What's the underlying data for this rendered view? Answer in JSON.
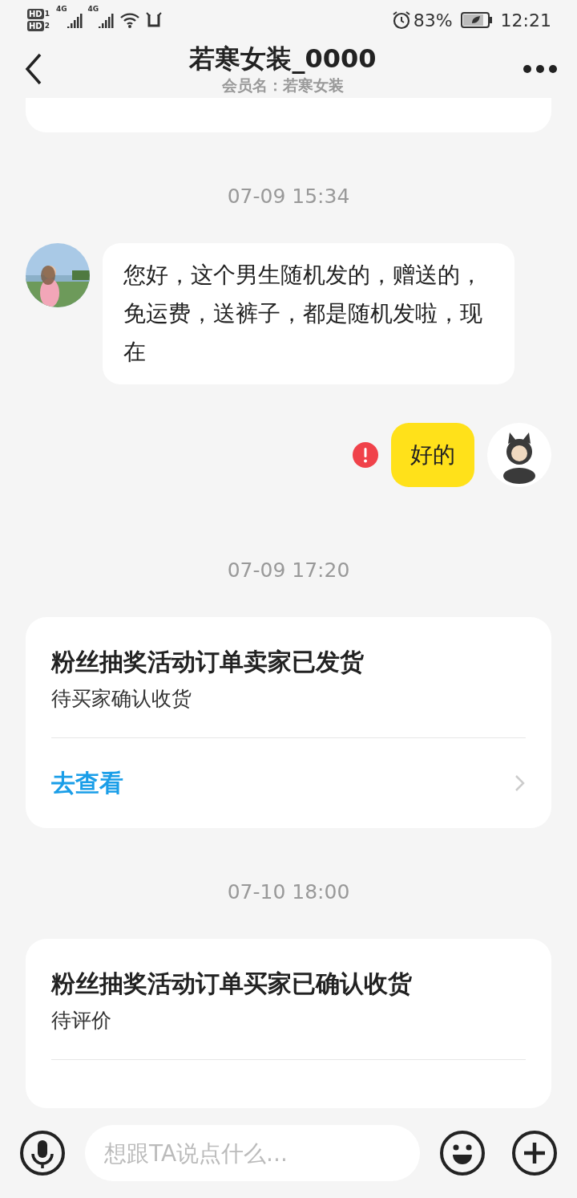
{
  "status_bar": {
    "sims": [
      {
        "badge": "HD",
        "slot": "1",
        "network": "4G"
      },
      {
        "badge": "HD",
        "slot": "2",
        "network": "4G"
      }
    ],
    "battery": "83%",
    "time": "12:21"
  },
  "header": {
    "title": "若寒女装_0000",
    "subtitle": "会员名：若寒女装"
  },
  "messages": [
    {
      "kind": "card_stub"
    },
    {
      "kind": "time",
      "text": "07-09 15:34"
    },
    {
      "kind": "received",
      "text": "您好，这个男生随机发的，赠送的，免运费，送裤子，都是随机发啦，现在"
    },
    {
      "kind": "sent",
      "text": "好的",
      "failed": true
    },
    {
      "kind": "time",
      "text": "07-09 17:20"
    },
    {
      "kind": "order_card",
      "title": "粉丝抽奖活动订单卖家已发货",
      "subtitle": "待买家确认收货",
      "link": "去查看"
    },
    {
      "kind": "time",
      "text": "07-10 18:00"
    },
    {
      "kind": "order_card",
      "title": "粉丝抽奖活动订单买家已确认收货",
      "subtitle": "待评价"
    }
  ],
  "input": {
    "placeholder": "想跟TA说点什么..."
  }
}
